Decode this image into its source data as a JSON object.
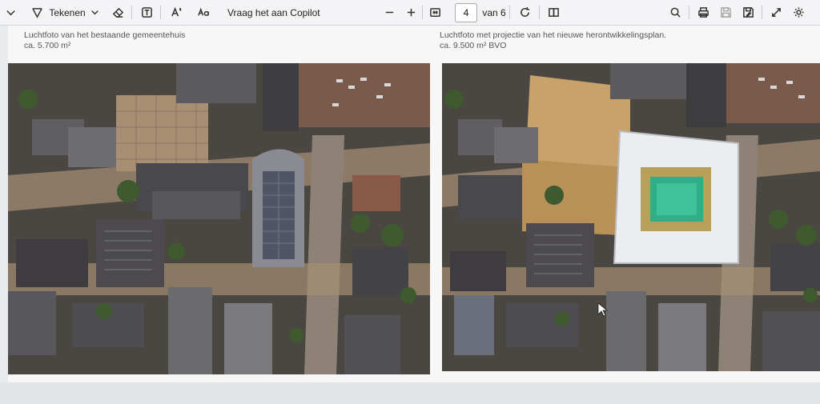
{
  "toolbar": {
    "draw_label": "Tekenen",
    "copilot_label": "Vraag het aan Copilot",
    "page_value": "4",
    "page_total_label": "van 6"
  },
  "document": {
    "left": {
      "caption_line1": "Luchtfoto van het bestaande gemeentehuis",
      "caption_line2": "ca. 5.700 m²"
    },
    "right": {
      "caption_line1": "Luchtfoto met projectie van het nieuwe herontwikkelingsplan.",
      "caption_line2": "ca. 9.500 m² BVO"
    }
  },
  "icons": [
    "chevron-down-icon",
    "draw-icon",
    "chevron-down-icon",
    "eraser-icon",
    "text-box-icon",
    "read-aloud-icon",
    "translate-icon",
    "minus-icon",
    "plus-icon",
    "fit-page-icon",
    "rotate-icon",
    "page-view-icon",
    "search-icon",
    "print-icon",
    "save-icon",
    "save-as-icon",
    "fullscreen-icon",
    "settings-icon"
  ]
}
